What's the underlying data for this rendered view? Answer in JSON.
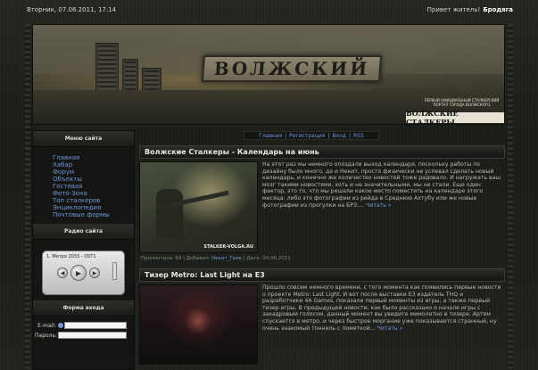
{
  "topbar": {
    "date": "Вторник, 07.06.2011, 17:14",
    "greeting": "Привет житель!",
    "username": "Бродяга"
  },
  "banner": {
    "logo_text": "ВОЛЖСКИЙ",
    "subtitle": "ПЕРВЫЙ ОФИЦИАЛЬНЫЙ СТАЛКЕРСКИЙ ПОРТАЛ ГОРОДА ВОЛЖСКОГО",
    "brand": "ВОЛЖСКИЕ СТАЛКЕРЫ"
  },
  "topnav": {
    "home": "Главная",
    "register": "Регистрация",
    "login": "Вход",
    "rss": "RSS",
    "separator": "|"
  },
  "sidebar": {
    "menu_title": "Меню сайта",
    "menu_items": [
      "Главная",
      "Хабар",
      "Форум",
      "Объекты",
      "Гостевая",
      "Фото-Зона",
      "Топ сталкеров",
      "Энциклопедия",
      "Почтовые формы"
    ],
    "radio_title": "Радио сайта",
    "player_track": "1. Метро 2033 - OST1",
    "login_title": "Форма входа",
    "email_label": "E-mail:",
    "password_label": "Пароль:"
  },
  "posts": [
    {
      "title": "Волжские Сталкеры - Календарь на июнь",
      "text": "На этот раз мы немного опоздали выход календаря, поскольку работы по дизайну было много, да и Некит, просто физически не успевал сделать новый календарь, и конечно же количество новостей тоже радовало. И нагружать ваш мозг такими новостями, хоть и не значительными, мы не стали. Еще один фактор, это то, что мы решали какое место поместить на календаре этого месяца: либо это фотографии из рейда в Среднюю Ахтубу или же новые фотографии из прогулки на БРЗ....",
      "more": "Читать »",
      "watermark": "STALKER-VOLGA.RU",
      "meta_views": "Просмотров: 64",
      "meta_added_label": "Добавил:",
      "meta_author": "Некит_Грек",
      "meta_date": "Дата: 04.06.2011",
      "meta_sep": "|"
    },
    {
      "title": "Тизер Metro: Last Light на E3",
      "text": "Прошло совсем немного времени, с того момента как появились первые новости о проекте Metro: Last Light. И вот после выставки E3 издатель THQ и разработчики 4A Games, показали первый моменты из игры, а также первый тизер игры. В предыдущей новости, как было рассказано о начале игры с закадровым голосом, данный момент вы увидите мимолетно в тизере, Артем спускается в метро, и через быстрое моргание уже показывается странный, ну очень знакомый тоннель с пометкой...",
      "more": "Читать »"
    }
  ],
  "colors": {
    "link": "#6f97d8",
    "background": "#1b1d1a",
    "text": "#b9bcb4"
  }
}
